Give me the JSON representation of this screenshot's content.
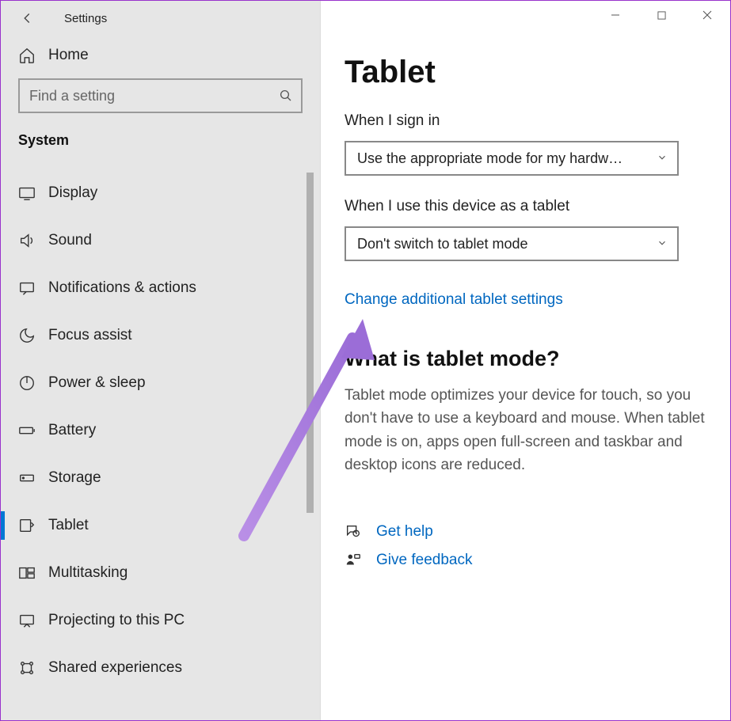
{
  "app_title": "Settings",
  "home_label": "Home",
  "search_placeholder": "Find a setting",
  "category_label": "System",
  "nav_items": [
    {
      "label": "Display"
    },
    {
      "label": "Sound"
    },
    {
      "label": "Notifications & actions"
    },
    {
      "label": "Focus assist"
    },
    {
      "label": "Power & sleep"
    },
    {
      "label": "Battery"
    },
    {
      "label": "Storage"
    },
    {
      "label": "Tablet"
    },
    {
      "label": "Multitasking"
    },
    {
      "label": "Projecting to this PC"
    },
    {
      "label": "Shared experiences"
    }
  ],
  "page_title": "Tablet",
  "setting1": {
    "label": "When I sign in",
    "value": "Use the appropriate mode for my hardw…"
  },
  "setting2": {
    "label": "When I use this device as a tablet",
    "value": "Don't switch to tablet mode"
  },
  "link_additional": "Change additional tablet settings",
  "info_heading": "What is tablet mode?",
  "info_body": "Tablet mode optimizes your device for touch, so you don't have to use a keyboard and mouse. When tablet mode is on, apps open full-screen and taskbar and desktop icons are reduced.",
  "help_link": "Get help",
  "feedback_link": "Give feedback"
}
